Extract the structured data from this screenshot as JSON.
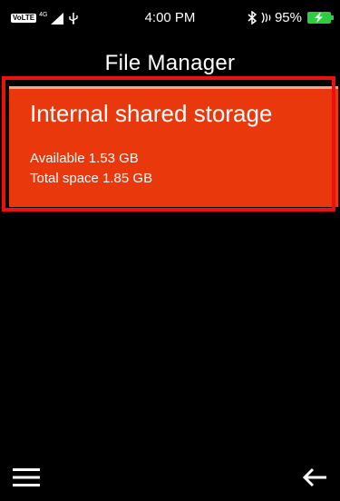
{
  "status_bar": {
    "volte": "VoLTE",
    "network": "4G",
    "time": "4:00 PM",
    "battery": "95%",
    "battery_color": "#2ecc40"
  },
  "app": {
    "title": "File Manager"
  },
  "storage": {
    "name": "Internal shared storage",
    "available": "Available 1.53 GB",
    "total": "Total space 1.85 GB",
    "card_color": "#e8380c",
    "highlight_color": "#ee1010"
  },
  "icons": {
    "menu": "hamburger-menu-icon",
    "back": "back-arrow-icon"
  }
}
